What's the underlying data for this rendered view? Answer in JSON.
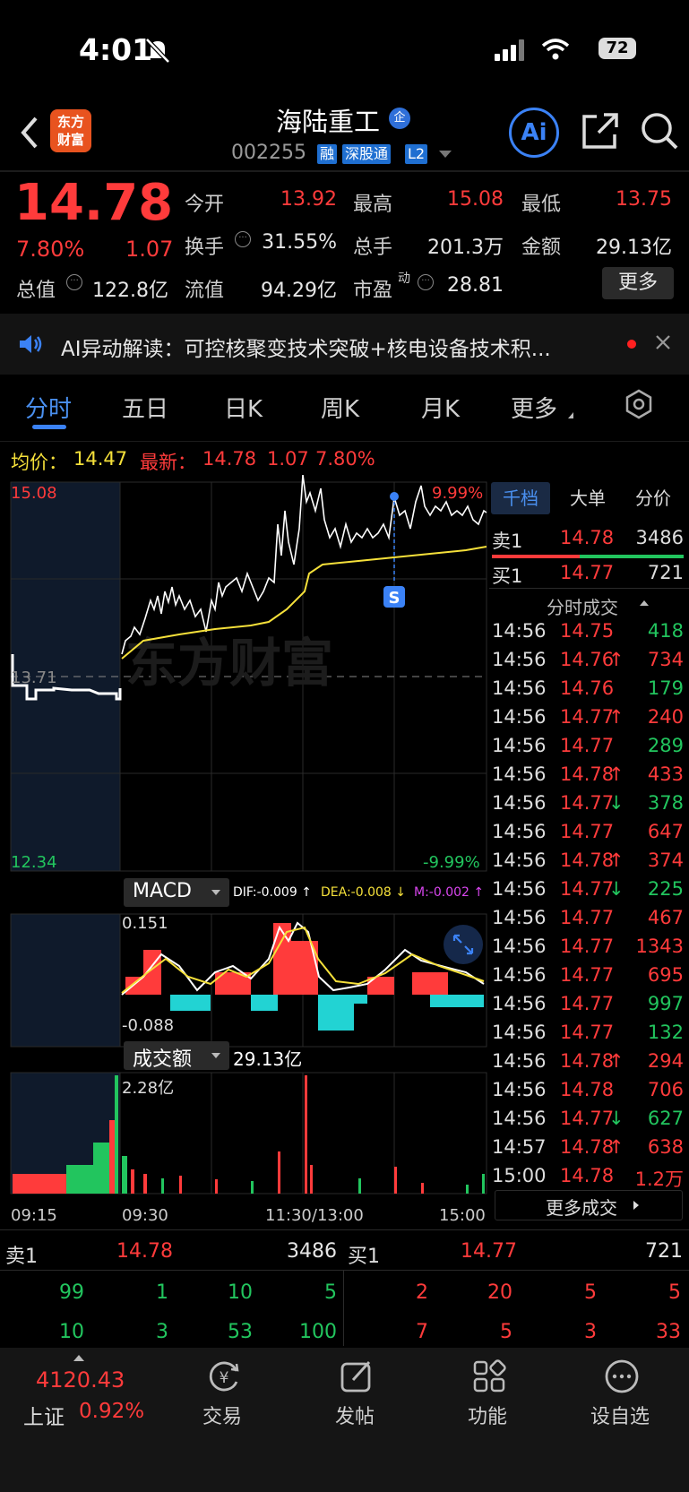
{
  "status": {
    "time": "4:01",
    "battery": "72"
  },
  "header": {
    "logo_line1": "东方",
    "logo_line2": "财富",
    "name": "海陆重工",
    "badge": "企",
    "code": "002255",
    "tags": [
      "融",
      "深股通",
      "L2"
    ],
    "ai_label": "Ai"
  },
  "quote": {
    "price": "14.78",
    "pct": "7.80%",
    "change": "1.07",
    "open_label": "今开",
    "open": "13.92",
    "high_label": "最高",
    "high": "15.08",
    "low_label": "最低",
    "low": "13.75",
    "turnover_label": "换手",
    "turnover": "31.55%",
    "vol_label": "总手",
    "vol": "201.3万",
    "amount_label": "金额",
    "amount": "29.13亿",
    "mcap_label": "总值",
    "mcap": "122.8亿",
    "float_label": "流值",
    "float": "94.29亿",
    "pe_label": "市盈",
    "pe_sup": "动",
    "pe": "28.81",
    "more_button": "更多"
  },
  "notice": {
    "text": "AI异动解读：可控核聚变技术突破+核电设备技术积..."
  },
  "tabs": [
    "分时",
    "五日",
    "日K",
    "周K",
    "月K",
    "更多"
  ],
  "avg_line": {
    "avg_label": "均价：",
    "avg": "14.47",
    "latest_label": "最新：",
    "latest": "14.78",
    "chg": "1.07",
    "pct": "7.80%"
  },
  "chart": {
    "y_high": "15.08",
    "y_low": "12.34",
    "y_mid": "13.71",
    "pct_high": "9.99%",
    "pct_low": "-9.99%",
    "watermark": "东方财富",
    "signal": "S",
    "times": [
      "09:15",
      "09:30",
      "11:30/13:00",
      "15:00"
    ]
  },
  "macd": {
    "selector": "MACD",
    "dif": "DIF:-0.009 ↑",
    "dea": "DEA:-0.008 ↓",
    "m": "M:-0.002 ↑",
    "max": "0.151",
    "min": "-0.088"
  },
  "volume": {
    "selector": "成交额",
    "total": "29.13亿",
    "max": "2.28亿"
  },
  "book_tabs": [
    "千档",
    "大单",
    "分价"
  ],
  "level1": {
    "ask_label": "卖1",
    "ask_price": "14.78",
    "ask_vol": "3486",
    "bid_label": "买1",
    "bid_price": "14.77",
    "bid_vol": "721"
  },
  "trades_title": "分时成交",
  "trades": [
    {
      "t": "14:56",
      "p": "14.75",
      "a": "",
      "v": "418",
      "c": "green"
    },
    {
      "t": "14:56",
      "p": "14.76",
      "a": "↑",
      "v": "734",
      "c": "red"
    },
    {
      "t": "14:56",
      "p": "14.76",
      "a": "",
      "v": "179",
      "c": "green"
    },
    {
      "t": "14:56",
      "p": "14.77",
      "a": "↑",
      "v": "240",
      "c": "red"
    },
    {
      "t": "14:56",
      "p": "14.77",
      "a": "",
      "v": "289",
      "c": "green"
    },
    {
      "t": "14:56",
      "p": "14.78",
      "a": "↑",
      "v": "433",
      "c": "red"
    },
    {
      "t": "14:56",
      "p": "14.77",
      "a": "↓",
      "v": "378",
      "c": "green"
    },
    {
      "t": "14:56",
      "p": "14.77",
      "a": "",
      "v": "647",
      "c": "red"
    },
    {
      "t": "14:56",
      "p": "14.78",
      "a": "↑",
      "v": "374",
      "c": "red"
    },
    {
      "t": "14:56",
      "p": "14.77",
      "a": "↓",
      "v": "225",
      "c": "green"
    },
    {
      "t": "14:56",
      "p": "14.77",
      "a": "",
      "v": "467",
      "c": "red"
    },
    {
      "t": "14:56",
      "p": "14.77",
      "a": "",
      "v": "1343",
      "c": "red"
    },
    {
      "t": "14:56",
      "p": "14.77",
      "a": "",
      "v": "695",
      "c": "red"
    },
    {
      "t": "14:56",
      "p": "14.77",
      "a": "",
      "v": "997",
      "c": "green"
    },
    {
      "t": "14:56",
      "p": "14.77",
      "a": "",
      "v": "132",
      "c": "green"
    },
    {
      "t": "14:56",
      "p": "14.78",
      "a": "↑",
      "v": "294",
      "c": "red"
    },
    {
      "t": "14:56",
      "p": "14.78",
      "a": "",
      "v": "706",
      "c": "red"
    },
    {
      "t": "14:56",
      "p": "14.77",
      "a": "↓",
      "v": "627",
      "c": "green"
    },
    {
      "t": "14:57",
      "p": "14.78",
      "a": "↑",
      "v": "638",
      "c": "red"
    },
    {
      "t": "15:00",
      "p": "14.78",
      "a": "",
      "v": "1.2万",
      "c": "red"
    }
  ],
  "more_trades": "更多成交",
  "book_bottom": {
    "ask_label": "卖1",
    "ask_price": "14.78",
    "ask_vol": "3486",
    "bid_label": "买1",
    "bid_price": "14.77",
    "bid_vol": "721",
    "ask_row1": [
      "99",
      "1",
      "10",
      "5"
    ],
    "ask_row2": [
      "10",
      "3",
      "53",
      "100"
    ],
    "bid_row1": [
      "2",
      "20",
      "5",
      "5"
    ],
    "bid_row2": [
      "7",
      "5",
      "3",
      "33"
    ]
  },
  "nav": {
    "index_value": "4120.43",
    "index_name": "上证",
    "index_pct": "0.92%",
    "items": [
      "交易",
      "发帖",
      "功能",
      "设自选"
    ]
  },
  "colors": {
    "up": "#ff3b3b",
    "down": "#22c55e",
    "avg": "#f5e03a",
    "accent": "#3b82f6"
  }
}
